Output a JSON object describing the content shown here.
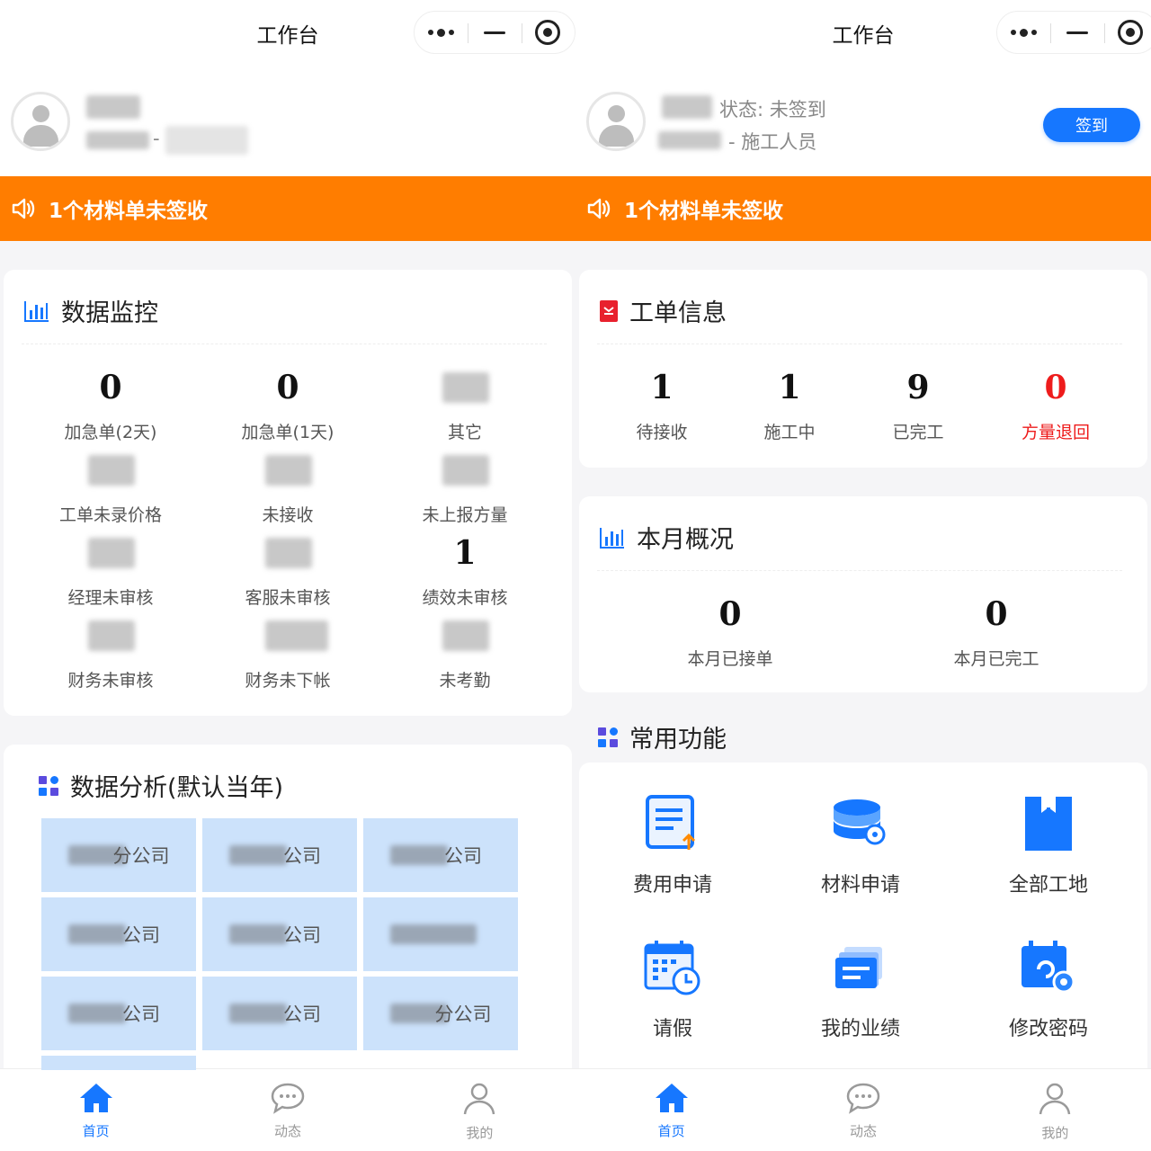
{
  "left": {
    "nav_title": "工作台",
    "user_dash": "-",
    "notice": "1个材料单未签收",
    "monitor": {
      "title": "数据监控",
      "stats": [
        {
          "value": "0",
          "label": "加急单(2天)"
        },
        {
          "value": "0",
          "label": "加急单(1天)"
        },
        {
          "value": "",
          "label": "其它"
        },
        {
          "value": "",
          "label": "工单未录价格"
        },
        {
          "value": "",
          "label": "未接收"
        },
        {
          "value": "",
          "label": "未上报方量"
        },
        {
          "value": "",
          "label": "经理未审核"
        },
        {
          "value": "",
          "label": "客服未审核"
        },
        {
          "value": "1",
          "label": "绩效未审核"
        },
        {
          "value": "",
          "label": "财务未审核"
        },
        {
          "value": "",
          "label": "财务未下帐"
        },
        {
          "value": "",
          "label": "未考勤"
        }
      ]
    },
    "analysis": {
      "title": "数据分析(默认当年)",
      "cells": [
        "分公司",
        "公司",
        "公司",
        "公司",
        "公司",
        "",
        "公司",
        "公司",
        "分公司"
      ]
    }
  },
  "right": {
    "nav_title": "工作台",
    "status": "状态: 未签到",
    "role": "- 施工人员",
    "sign_label": "签到",
    "notice": "1个材料单未签收",
    "workorder": {
      "title": "工单信息",
      "stats": [
        {
          "value": "1",
          "label": "待接收"
        },
        {
          "value": "1",
          "label": "施工中"
        },
        {
          "value": "9",
          "label": "已完工"
        },
        {
          "value": "0",
          "label": "方量退回"
        }
      ]
    },
    "month": {
      "title": "本月概况",
      "stats": [
        {
          "value": "0",
          "label": "本月已接单"
        },
        {
          "value": "0",
          "label": "本月已完工"
        }
      ]
    },
    "functions": {
      "title": "常用功能",
      "items": [
        {
          "label": "费用申请",
          "icon": "expense-doc-icon"
        },
        {
          "label": "材料申请",
          "icon": "database-icon"
        },
        {
          "label": "全部工地",
          "icon": "folder-icon"
        },
        {
          "label": "请假",
          "icon": "calendar-clock-icon"
        },
        {
          "label": "我的业绩",
          "icon": "stack-icon"
        },
        {
          "label": "修改密码",
          "icon": "calendar-gear-icon"
        }
      ]
    }
  },
  "tabs": [
    {
      "label": "首页",
      "icon": "home-icon",
      "active": true
    },
    {
      "label": "动态",
      "icon": "chat-icon",
      "active": false
    },
    {
      "label": "我的",
      "icon": "user-icon",
      "active": false
    }
  ],
  "colors": {
    "primary": "#1677ff",
    "notice_bg": "#ff7d00",
    "danger": "#ee1c1c",
    "grid_bg": "#cce2fb"
  }
}
